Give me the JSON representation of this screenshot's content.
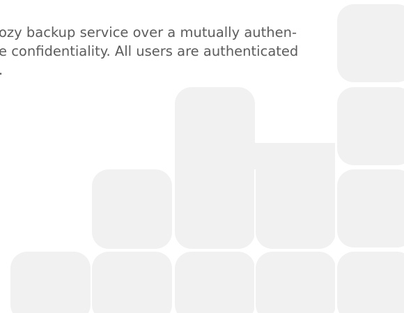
{
  "body_text": {
    "lines": [
      "ozy backup service over a mutually authen-",
      "e confidentiality. All users are authenticated",
      "."
    ]
  },
  "colors": {
    "background": "#ffffff",
    "text": "#5c5c5c",
    "tile_fill": "#f1f1f2"
  }
}
